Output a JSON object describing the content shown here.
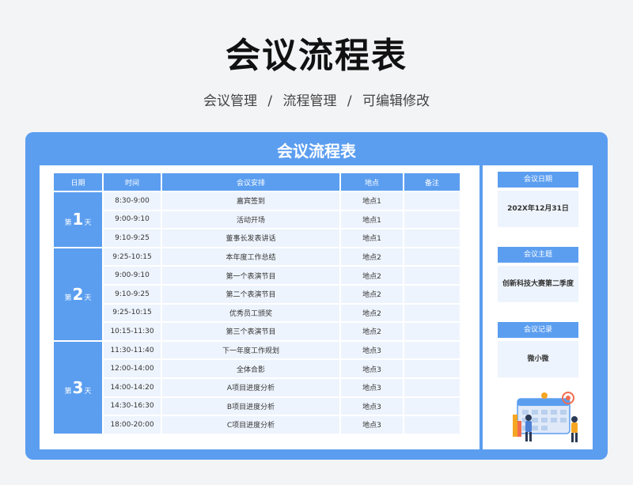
{
  "page": {
    "title": "会议流程表",
    "breadcrumb": [
      "会议管理",
      "流程管理",
      "可编辑修改"
    ],
    "separator": "/"
  },
  "sheet": {
    "title": "会议流程表",
    "headers": [
      "日期",
      "时间",
      "会议安排",
      "地点",
      "备注"
    ],
    "days": [
      {
        "prefix": "第",
        "number": "1",
        "suffix": "天",
        "rows": [
          {
            "time": "8:30-9:00",
            "agenda": "嘉宾签到",
            "place": "地点1",
            "note": ""
          },
          {
            "time": "9:00-9:10",
            "agenda": "活动开场",
            "place": "地点1",
            "note": ""
          },
          {
            "time": "9:10-9:25",
            "agenda": "董事长发表讲话",
            "place": "地点1",
            "note": ""
          }
        ]
      },
      {
        "prefix": "第",
        "number": "2",
        "suffix": "天",
        "rows": [
          {
            "time": "9:25-10:15",
            "agenda": "本年度工作总结",
            "place": "地点2",
            "note": ""
          },
          {
            "time": "9:00-9:10",
            "agenda": "第一个表演节目",
            "place": "地点2",
            "note": ""
          },
          {
            "time": "9:10-9:25",
            "agenda": "第二个表演节目",
            "place": "地点2",
            "note": ""
          },
          {
            "time": "9:25-10:15",
            "agenda": "优秀员工颁奖",
            "place": "地点2",
            "note": ""
          },
          {
            "time": "10:15-11:30",
            "agenda": "第三个表演节目",
            "place": "地点2",
            "note": ""
          }
        ]
      },
      {
        "prefix": "第",
        "number": "3",
        "suffix": "天",
        "rows": [
          {
            "time": "11:30-11:40",
            "agenda": "下一年度工作规划",
            "place": "地点3",
            "note": ""
          },
          {
            "time": "12:00-14:00",
            "agenda": "全体合影",
            "place": "地点3",
            "note": ""
          },
          {
            "time": "14:00-14:20",
            "agenda": "A项目进度分析",
            "place": "地点3",
            "note": ""
          },
          {
            "time": "14:30-16:30",
            "agenda": "B项目进度分析",
            "place": "地点3",
            "note": ""
          },
          {
            "time": "18:00-20:00",
            "agenda": "C项目进度分析",
            "place": "地点3",
            "note": ""
          }
        ]
      }
    ]
  },
  "info": {
    "cards": [
      {
        "label": "会议日期",
        "value": "202X年12月31日"
      },
      {
        "label": "会议主题",
        "value": "创新科技大赛第二季度"
      },
      {
        "label": "会议记录",
        "value": "微小微"
      }
    ]
  },
  "colors": {
    "accent": "#5b9ef0",
    "cell": "#eef4fd",
    "illustration_accent": "#f26b4f"
  },
  "illustration": {
    "icon": "calendar-people-icon"
  }
}
